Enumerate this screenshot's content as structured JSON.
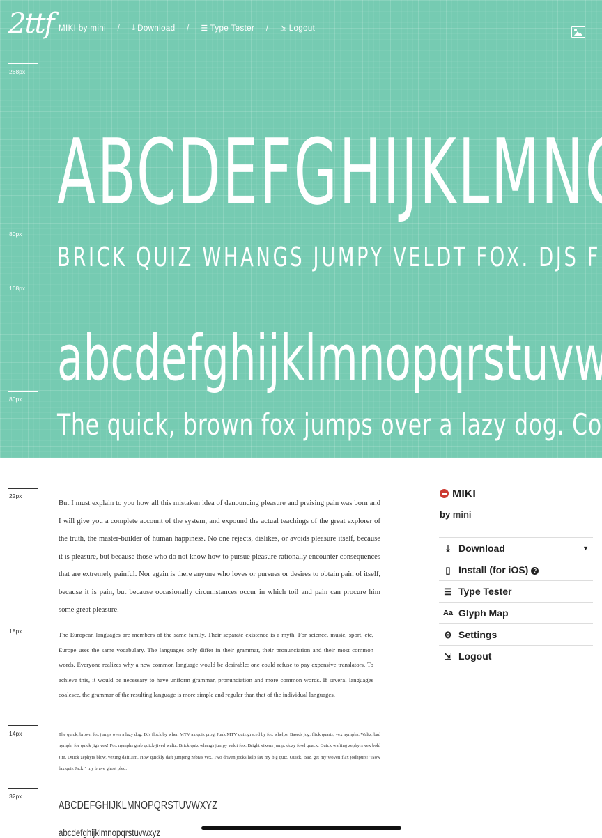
{
  "header": {
    "logo": "2ttf",
    "nav": [
      {
        "label": "MIKI by mini",
        "icon": ""
      },
      {
        "label": "Download",
        "icon": "download-icon"
      },
      {
        "label": "Type Tester",
        "icon": "type-tester-icon"
      },
      {
        "label": "Logout",
        "icon": "logout-icon"
      }
    ],
    "separator": "/",
    "image_toggle_icon": "image-icon"
  },
  "hero": {
    "background": "#76cbb2",
    "samples": [
      {
        "size": "268px",
        "text": "ABCDEFGHIJKLMNOPQRSTUVWXYZ"
      },
      {
        "size": "80px",
        "text": "BRICK QUIZ WHANGS JUMPY VELDT FOX. DJS FLOCK BY WHEN MTV AX QUIZ PROG."
      },
      {
        "size": "168px",
        "text": "abcdefghijklmnopqrstuvwxyz"
      },
      {
        "size": "80px",
        "text": "The quick, brown fox jumps over a lazy dog. Cozy sphinx waves quart jug of bad milk."
      }
    ]
  },
  "samples": {
    "s22": {
      "size": "22px",
      "text": "But I must explain to you how all this mistaken idea of denouncing pleasure and praising pain was born and I will give you a complete account of the system, and expound the actual teachings of the great explorer of the truth, the master-builder of human happiness. No one rejects, dislikes, or avoids pleasure itself, because it is pleasure, but because those who do not know how to pursue pleasure rationally encounter consequences that are extremely painful. Nor again is there anyone who loves or pursues or desires to obtain pain of itself, because it is pain, but because occasionally circumstances occur in which toil and pain can procure him some great pleasure."
    },
    "s18": {
      "size": "18px",
      "text": "The European languages are members of the same family. Their separate existence is a myth. For science, music, sport, etc, Europe uses the same vocabulary. The languages only differ in their grammar, their pronunciation and their most common words. Everyone realizes why a new common language would be desirable: one could refuse to pay expensive translators. To achieve this, it would be necessary to have uniform grammar, pronunciation and more common words. If several languages coalesce, the grammar of the resulting language is more simple and regular than that of the individual languages."
    },
    "s14": {
      "size": "14px",
      "text": "The quick, brown fox jumps over a lazy dog. DJs flock by when MTV ax quiz prog. Junk MTV quiz graced by fox whelps. Bawds jog, flick quartz, vex nymphs. Waltz, bad nymph, for quick jigs vex! Fox nymphs grab quick-jived waltz. Brick quiz whangs jumpy veldt fox. Bright vixens jump; dozy fowl quack. Quick wafting zephyrs vex bold Jim. Quick zephyrs blow, vexing daft Jim. How quickly daft jumping zebras vex. Two driven jocks help fax my big quiz. Quick, Baz, get my woven flax jodhpurs! \"Now fax quiz Jack!\" my brave ghost pled."
    },
    "s32": {
      "size": "32px",
      "caps": "ABCDEFGHIJKLMNOPQRSTUVWXYZ",
      "lower": "abcdefghijklmnopqrstuvwxyz"
    }
  },
  "sidebar": {
    "font_name": "MIKI",
    "by_label": "by",
    "author": "mini",
    "menu": [
      {
        "label": "Download",
        "icon": "download-icon",
        "has_caret": true
      },
      {
        "label": "Install (for iOS)",
        "icon": "phone-icon",
        "help": "?"
      },
      {
        "label": "Type Tester",
        "icon": "type-tester-icon"
      },
      {
        "label": "Glyph Map",
        "icon": "glyph-map-icon",
        "icon_text": "Aa"
      },
      {
        "label": "Settings",
        "icon": "gear-icon"
      },
      {
        "label": "Logout",
        "icon": "logout-icon"
      }
    ]
  }
}
